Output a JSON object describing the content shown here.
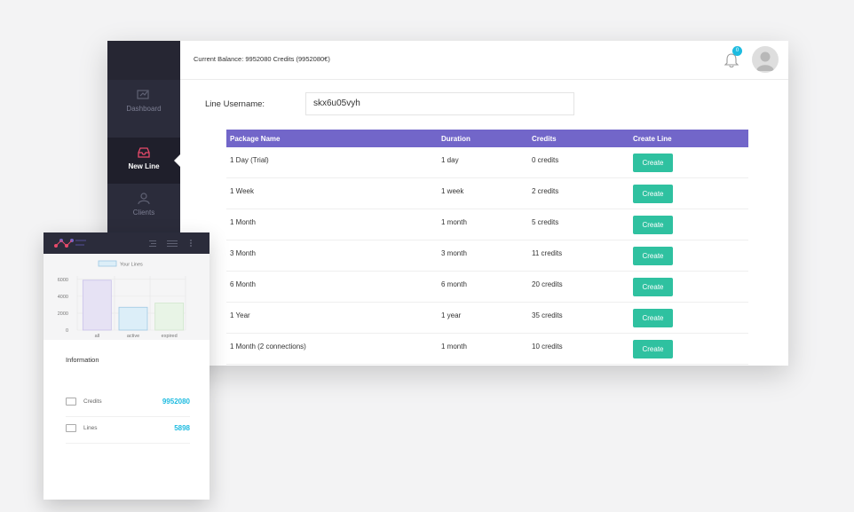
{
  "header": {
    "balance": "Current Balance: 9952080 Credits (9952080€)",
    "notifications_count": "0"
  },
  "sidebar": {
    "items": [
      {
        "label": "Dashboard",
        "icon": "dashboard-icon"
      },
      {
        "label": "New Line",
        "icon": "inbox-icon",
        "active": true
      },
      {
        "label": "Clients",
        "icon": "user-icon"
      }
    ]
  },
  "form": {
    "username_label": "Line Username:",
    "username_value": "skx6u05vyh"
  },
  "table": {
    "headers": [
      "Package Name",
      "Duration",
      "Credits",
      "Create Line"
    ],
    "button_label": "Create",
    "rows": [
      [
        "1 Day (Trial)",
        "1 day",
        "0 credits"
      ],
      [
        "1 Week",
        "1 week",
        "2 credits"
      ],
      [
        "1 Month",
        "1 month",
        "5 credits"
      ],
      [
        "3 Month",
        "3 month",
        "11 credits"
      ],
      [
        "6 Month",
        "6 month",
        "20 credits"
      ],
      [
        "1 Year",
        "1 year",
        "35 credits"
      ],
      [
        "1 Month (2 connections)",
        "1 month",
        "10 credits"
      ]
    ]
  },
  "colors": {
    "table_header": "#7266c9",
    "create_button": "#2fc1a0",
    "accent": "#1dbbe0",
    "sidebar": "#2b2c3b"
  },
  "chart_data": {
    "type": "bar",
    "categories": [
      "all",
      "active",
      "expired"
    ],
    "values": [
      5898,
      2700,
      3200
    ],
    "series": [
      {
        "name": "Your Lines",
        "values": [
          5898,
          2700,
          3200
        ]
      }
    ],
    "title": "",
    "xlabel": "",
    "ylabel": "",
    "yticks": [
      "6000",
      "4000",
      "2000",
      "0"
    ],
    "ylim": [
      0,
      6400
    ],
    "bar_colors": [
      "#e6e2f4",
      "#dceef8",
      "#e8f4e6"
    ],
    "bar_borders": [
      "#c9c1ea",
      "#9fc9e4",
      "#d0e6cc"
    ]
  },
  "information": {
    "title": "Information",
    "items": [
      {
        "label": "Credits",
        "value": "9952080"
      },
      {
        "label": "Lines",
        "value": "5898"
      }
    ]
  }
}
